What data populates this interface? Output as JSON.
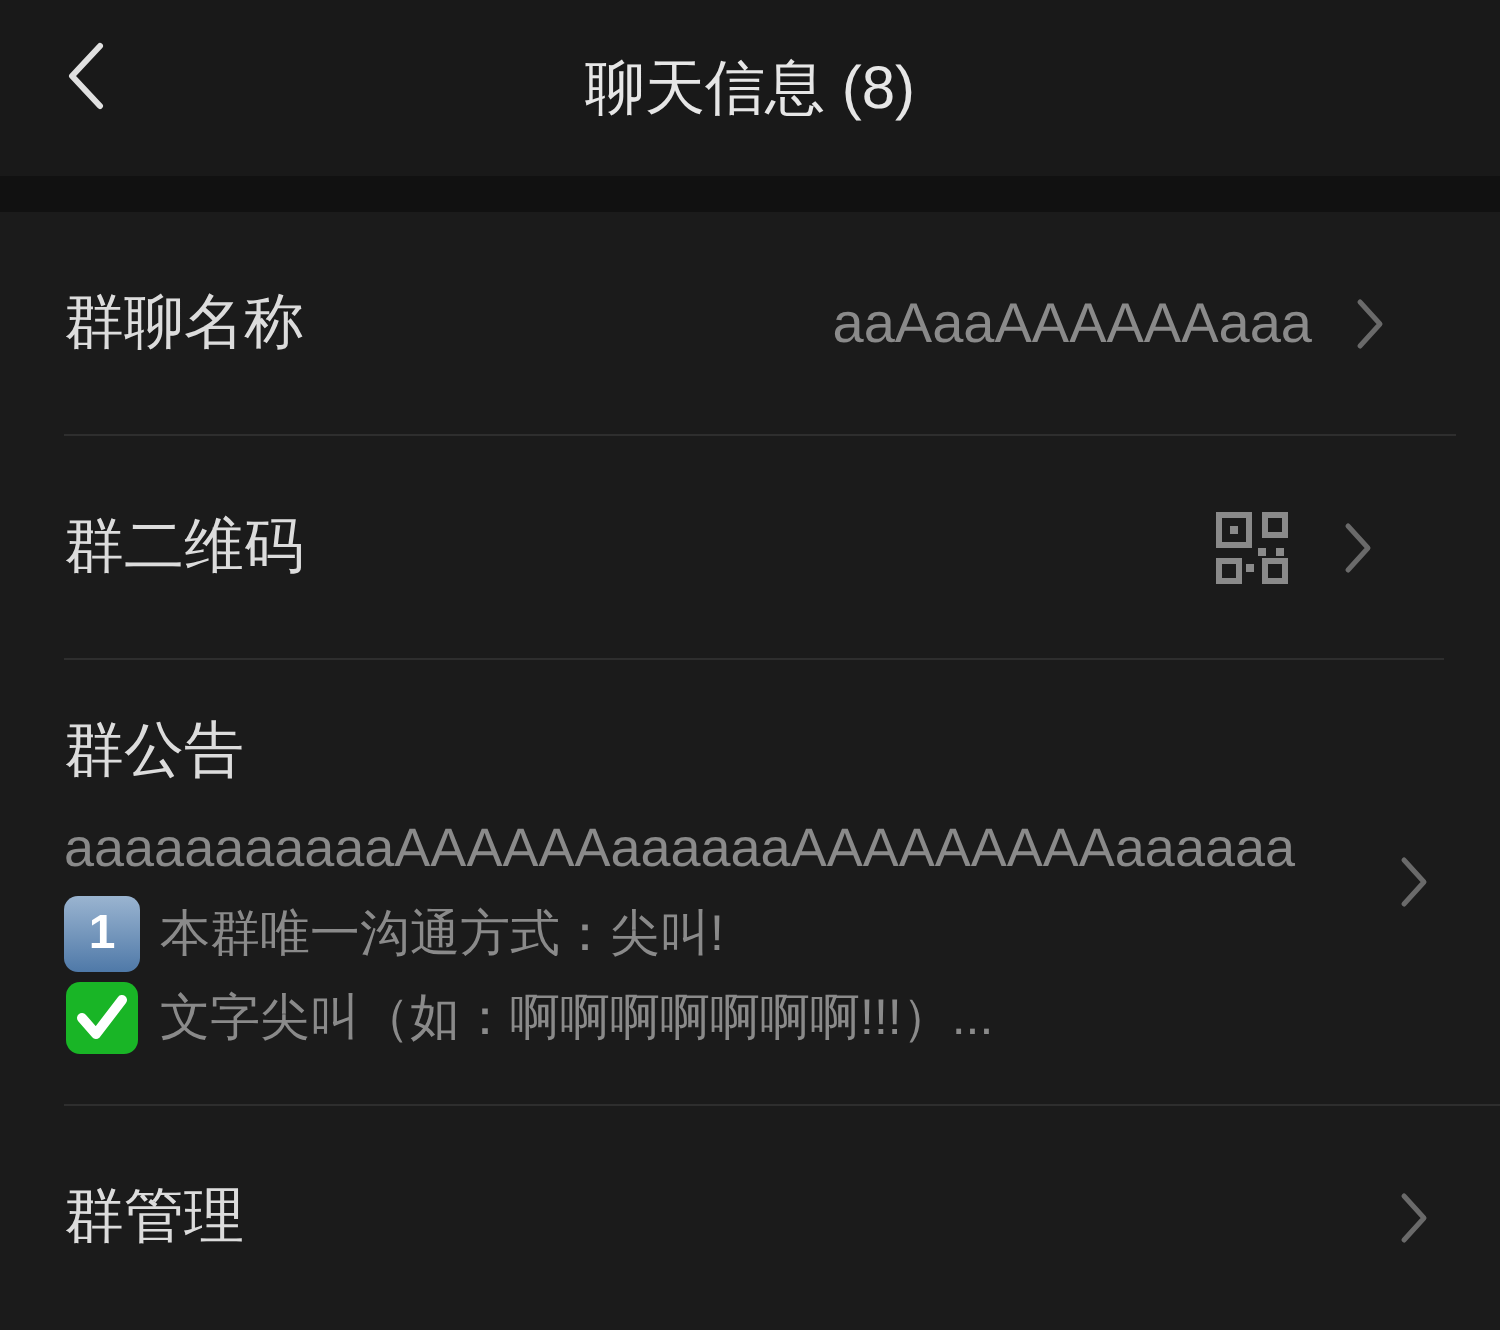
{
  "header": {
    "title": "聊天信息 (8)"
  },
  "rows": [
    {
      "kind": "value",
      "label": "群聊名称",
      "value": "aaAaaAAAAAAaaa"
    },
    {
      "kind": "qr",
      "label": "群二维码"
    },
    {
      "kind": "notice",
      "label": "群公告",
      "lines": [
        {
          "kind": "text",
          "text": "aaaaaaaaaaaAAAAAAaaaaaaAAAAAAAAAaaaaaa"
        },
        {
          "kind": "keycap",
          "badge": "1",
          "text": "本群唯一沟通方式：尖叫!"
        },
        {
          "kind": "check",
          "text": "文字尖叫（如：啊啊啊啊啊啊啊!!!）..."
        }
      ]
    },
    {
      "kind": "plain",
      "label": "群管理"
    }
  ]
}
